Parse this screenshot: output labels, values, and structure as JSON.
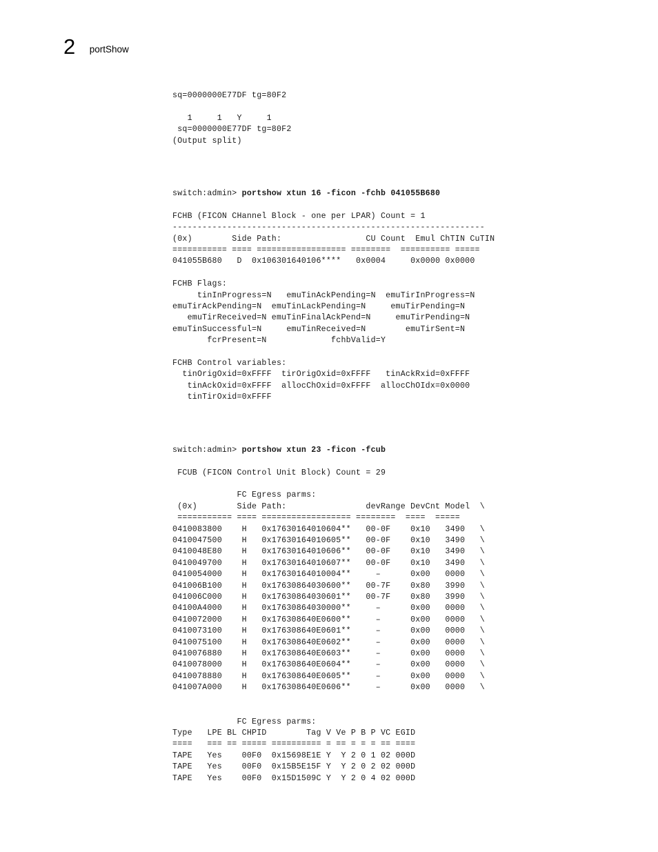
{
  "header": {
    "chapter_number": "2",
    "title": "portShow"
  },
  "listing": {
    "block1": [
      "sq=0000000E77DF tg=80F2",
      "",
      "   1     1   Y     1",
      " sq=0000000E77DF tg=80F2",
      "(Output split)"
    ],
    "command1_prompt": "switch:admin> ",
    "command1": "portshow xtun 16 -ficon -fchb 041055B680",
    "block2": [
      "FCHB (FICON CHannel Block - one per LPAR) Count = 1",
      "---------------------------------------------------------------",
      "(0x)        Side Path:                 CU Count  Emul ChTIN CuTIN",
      "=========== ==== ================== ========  ========== =====",
      "041055B680   D  0x106301640106****   0x0004     0x0000 0x0000"
    ],
    "block3": [
      "FCHB Flags:",
      "     tinInProgress=N   emuTinAckPending=N  emuTirInProgress=N",
      "emuTirAckPending=N  emuTinLackPending=N     emuTirPending=N",
      "   emuTirReceived=N emuTinFinalAckPend=N     emuTirPending=N",
      "emuTinSuccessful=N     emuTinReceived=N        emuTirSent=N",
      "       fcrPresent=N             fchbValid=Y"
    ],
    "block4": [
      "FCHB Control variables:",
      "  tinOrigOxid=0xFFFF  tirOrigOxid=0xFFFF   tinAckRxid=0xFFFF",
      "   tinAckOxid=0xFFFF  allocChOxid=0xFFFF  allocChOIdx=0x0000",
      "   tinTirOxid=0xFFFF"
    ],
    "command2_prompt": "switch:admin> ",
    "command2": "portshow xtun 23 -ficon -fcub",
    "block5": [
      " FCUB (FICON Control Unit Block) Count = 29",
      "",
      "             FC Egress parms:",
      " (0x)        Side Path:                devRange DevCnt Model  \\",
      " =========== ==== ================== ========  ====  ====="
    ],
    "fcub_rows": [
      "0410083800    H   0x17630164010604**   00-0F    0x10   3490   \\",
      "0410047500    H   0x17630164010605**   00-0F    0x10   3490   \\",
      "0410048E80    H   0x17630164010606**   00-0F    0x10   3490   \\",
      "0410049700    H   0x17630164010607**   00-0F    0x10   3490   \\",
      "0410054000    H   0x17630164010004**     –      0x00   0000   \\",
      "041006B100    H   0x17630864030600**   00-7F    0x80   3990   \\",
      "041006C000    H   0x17630864030601**   00-7F    0x80   3990   \\",
      "04100A4000    H   0x17630864030000**     –      0x00   0000   \\",
      "0410072000    H   0x176308640E0600**     –      0x00   0000   \\",
      "0410073100    H   0x176308640E0601**     –      0x00   0000   \\",
      "0410075100    H   0x176308640E0602**     –      0x00   0000   \\",
      "0410076880    H   0x176308640E0603**     –      0x00   0000   \\",
      "0410078000    H   0x176308640E0604**     –      0x00   0000   \\",
      "0410078880    H   0x176308640E0605**     –      0x00   0000   \\",
      "041007A000    H   0x176308640E0606**     –      0x00   0000   \\"
    ],
    "block6": [
      "             FC Egress parms:",
      "Type   LPE BL CHPID        Tag V Ve P B P VC EGID",
      "====   === == ===== ========== = == = = = == ====",
      "TAPE   Yes    00F0  0x15698E1E Y  Y 2 0 1 02 000D",
      "TAPE   Yes    00F0  0x15B5E15F Y  Y 2 0 2 02 000D",
      "TAPE   Yes    00F0  0x15D1509C Y  Y 2 0 4 02 000D"
    ]
  }
}
